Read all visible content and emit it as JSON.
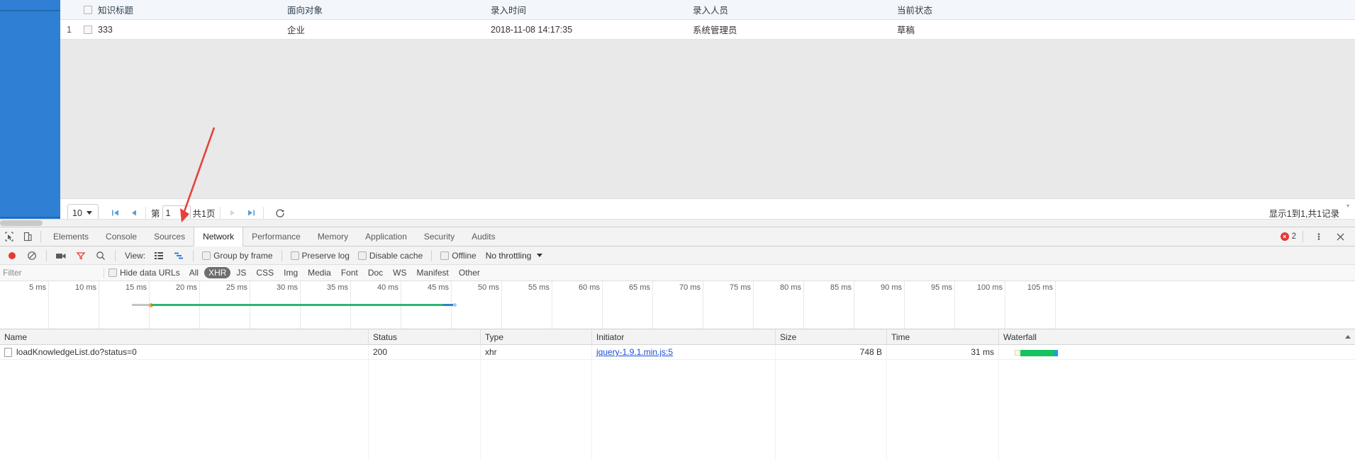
{
  "app": {
    "table": {
      "columns": [
        {
          "key": "num",
          "label": ""
        },
        {
          "key": "check",
          "label": ""
        },
        {
          "key": "title",
          "label": "知识标题"
        },
        {
          "key": "obj",
          "label": "面向对象"
        },
        {
          "key": "time",
          "label": "录入时间"
        },
        {
          "key": "user",
          "label": "录入人员"
        },
        {
          "key": "state",
          "label": "当前状态"
        }
      ],
      "rows": [
        {
          "num": "1",
          "title": "333",
          "obj": "企业",
          "time": "2018-11-08 14:17:35",
          "user": "系统管理员",
          "state": "草稿"
        }
      ]
    },
    "pager": {
      "page_size": "10",
      "first_icon": "first-page-icon",
      "prev_icon": "prev-page-icon",
      "next_icon": "next-page-icon",
      "last_icon": "last-page-icon",
      "refresh_icon": "refresh-icon",
      "page_prefix": "第",
      "page_number": "1",
      "page_total": "共1页",
      "info": "显示1到1,共1记录"
    }
  },
  "devtools": {
    "tabs": [
      {
        "label": "Elements",
        "active": false
      },
      {
        "label": "Console",
        "active": false
      },
      {
        "label": "Sources",
        "active": false
      },
      {
        "label": "Network",
        "active": true
      },
      {
        "label": "Performance",
        "active": false
      },
      {
        "label": "Memory",
        "active": false
      },
      {
        "label": "Application",
        "active": false
      },
      {
        "label": "Security",
        "active": false
      },
      {
        "label": "Audits",
        "active": false
      }
    ],
    "error_count": "2",
    "toolbar": {
      "record_icon": "record-icon",
      "clear_icon": "clear-icon",
      "camera_icon": "camera-icon",
      "filter_icon": "filter-icon",
      "search_icon": "search-icon",
      "view_label": "View:",
      "view_list_icon": "list-view-icon",
      "view_waterfall_icon": "waterfall-view-icon",
      "group_by_frame": "Group by frame",
      "preserve_log": "Preserve log",
      "disable_cache": "Disable cache",
      "offline": "Offline",
      "throttling": "No throttling"
    },
    "filterbar": {
      "placeholder": "Filter",
      "value": "",
      "hide_data_urls": "Hide data URLs",
      "types": [
        {
          "label": "All",
          "selected": false
        },
        {
          "label": "XHR",
          "selected": true
        },
        {
          "label": "JS",
          "selected": false
        },
        {
          "label": "CSS",
          "selected": false
        },
        {
          "label": "Img",
          "selected": false
        },
        {
          "label": "Media",
          "selected": false
        },
        {
          "label": "Font",
          "selected": false
        },
        {
          "label": "Doc",
          "selected": false
        },
        {
          "label": "WS",
          "selected": false
        },
        {
          "label": "Manifest",
          "selected": false
        },
        {
          "label": "Other",
          "selected": false
        }
      ]
    },
    "timeline": {
      "ticks": [
        "5 ms",
        "10 ms",
        "15 ms",
        "20 ms",
        "25 ms",
        "30 ms",
        "35 ms",
        "40 ms",
        "45 ms",
        "50 ms",
        "55 ms",
        "60 ms",
        "65 ms",
        "70 ms",
        "75 ms",
        "80 ms",
        "85 ms",
        "90 ms",
        "95 ms",
        "100 ms",
        "105 ms"
      ],
      "tick_spacing_px": 71,
      "first_tick_x": 68,
      "bar_gray_start_ms": 13.3,
      "bar_gray_end_ms": 15.2,
      "bar_green_end_ms": 44.2,
      "bar_blue_end_ms": 45.2
    },
    "requests": {
      "columns": [
        "Name",
        "Status",
        "Type",
        "Initiator",
        "Size",
        "Time",
        "Waterfall"
      ],
      "sort_column": "Waterfall",
      "sort_direction": "asc",
      "rows": [
        {
          "name": "loadKnowledgeList.do?status=0",
          "status": "200",
          "type": "xhr",
          "initiator": "jquery-1.9.1.min.js:5",
          "size": "748 B",
          "time": "31 ms"
        }
      ]
    }
  },
  "colors": {
    "sidebar_blue": "#2f80d4",
    "accent_green": "#15c25e",
    "accent_blue": "#2196f3",
    "error_red": "#e53935",
    "pointer_red": "#e8403a"
  }
}
